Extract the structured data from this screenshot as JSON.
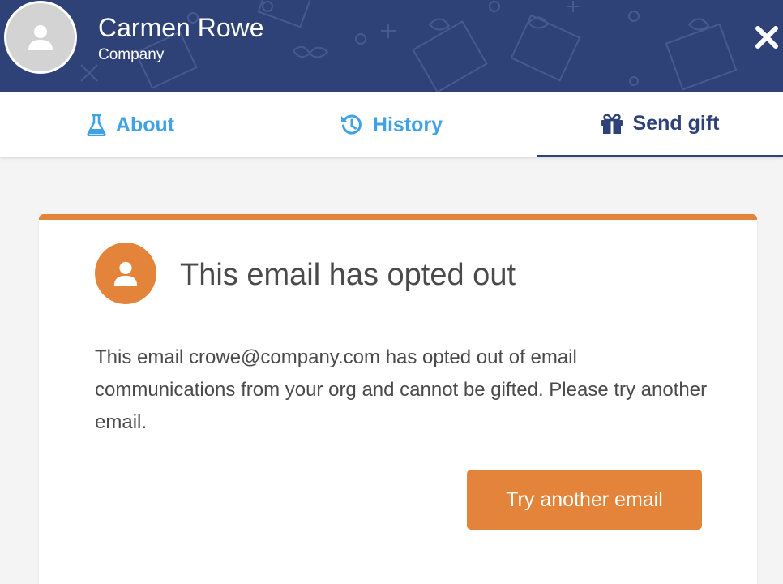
{
  "header": {
    "name": "Carmen Rowe",
    "company": "Company"
  },
  "tabs": [
    {
      "label": "About",
      "icon": "flask-icon",
      "active": false
    },
    {
      "label": "History",
      "icon": "history-icon",
      "active": false
    },
    {
      "label": "Send gift",
      "icon": "gift-icon",
      "active": true
    }
  ],
  "notice": {
    "title": "This email has opted out",
    "message": "This email crowe@company.com has opted out of email communications from your org and cannot be gifted. Please try another email.",
    "button_label": "Try another email"
  },
  "colors": {
    "header_bg": "#2f4277",
    "accent_orange": "#e4843b",
    "tab_link_blue": "#3fa2e6",
    "tab_active": "#2f4277"
  }
}
